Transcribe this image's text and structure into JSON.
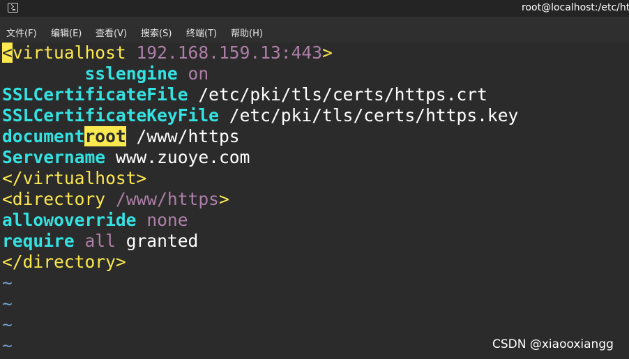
{
  "window": {
    "title": "root@localhost:/etc/ht"
  },
  "menu": [
    {
      "label": "文件(F)"
    },
    {
      "label": "编辑(E)"
    },
    {
      "label": "查看(V)"
    },
    {
      "label": "搜索(S)"
    },
    {
      "label": "终端(T)"
    },
    {
      "label": "帮助(H)"
    }
  ],
  "editor": {
    "l1": {
      "lt": "<",
      "tag": "virtualhost",
      "sp": " ",
      "addr": "192.168.159.13:443",
      "gt": ">"
    },
    "l2": {
      "indent": "        ",
      "kw": "sslengine",
      "sp": " ",
      "val": "on"
    },
    "l3": {
      "kw": "SSLCertificateFile",
      "rest": " /etc/pki/tls/certs/https.crt"
    },
    "l4": {
      "kw": "SSLCertificateKeyFile",
      "rest": " /etc/pki/tls/certs/https.key"
    },
    "l5": {
      "kw": "document",
      "hl": "root",
      "rest": " /www/https"
    },
    "l6": {
      "kw": "Servername",
      "rest": " www.zuoye.com"
    },
    "l7": {
      "text": "</virtualhost>"
    },
    "l8": {
      "tag": "<directory",
      "sp": " ",
      "path": "/www/https",
      "gt": ">"
    },
    "l9": {
      "kw": "allowoverride",
      "sp": " ",
      "val": "none"
    },
    "l10": {
      "kw": "require",
      "sp": " ",
      "val": "all",
      "rest": " granted"
    },
    "l11": {
      "text": "</directory>"
    },
    "tilde": "~"
  },
  "watermark": "CSDN @xiaooxiangg",
  "colors": {
    "background": "#2b2b2b",
    "keyword": "#34e2e2",
    "tag": "#fce94f",
    "value": "#ad7fa8",
    "tilde": "#729fcf",
    "cursor": "#fce94f"
  }
}
